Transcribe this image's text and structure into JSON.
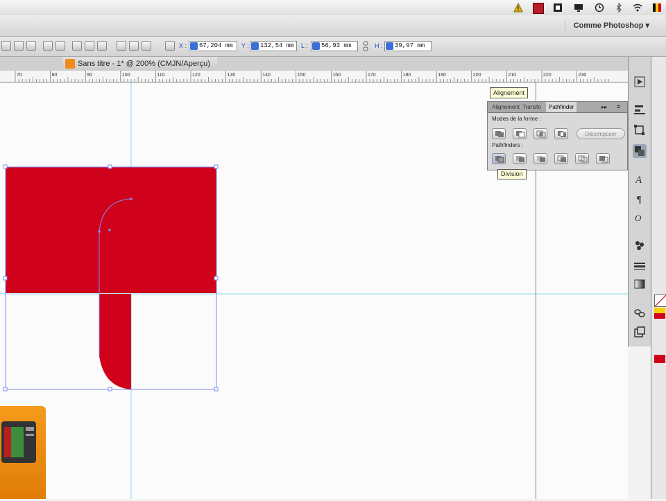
{
  "menubar": {
    "icons": [
      "warning-icon",
      "red-square-icon",
      "dropbox-icon",
      "screen-icon",
      "time-machine-icon",
      "bluetooth-icon",
      "wifi-icon",
      "flag-icon"
    ]
  },
  "workspace": {
    "label": "Comme Photoshop ▾"
  },
  "controlbar": {
    "x_label": "X :",
    "x_value": "67,204 mm",
    "y_label": "Y :",
    "y_value": "132,54 mm",
    "w_label": "L :",
    "w_value": "56,93 mm",
    "h_label": "H :",
    "h_value": "39,97 mm"
  },
  "document": {
    "tab_title": "Sans titre - 1* @ 200% (CMJN/Aperçu)"
  },
  "ruler": {
    "ticks": [
      "70",
      "80",
      "90",
      "100",
      "110",
      "120",
      "130",
      "140",
      "150",
      "160",
      "170",
      "180",
      "190",
      "200",
      "210",
      "220",
      "230"
    ]
  },
  "pathfinder": {
    "tooltip_top": "Alignement",
    "tabs": [
      "Alignement",
      "Transfo",
      "Pathfinder"
    ],
    "active_tab": "Pathfinder",
    "shape_modes_label": "Modes de la forme :",
    "expand_label": "Décomposer",
    "pathfinders_label": "Pathfinders :",
    "tooltip_hover": "Division"
  },
  "colors": {
    "shape_red": "#d0021b",
    "guide": "#7fd8f0",
    "accent_blue": "#3b6fd6",
    "logo_orange": "#f08a1a"
  }
}
